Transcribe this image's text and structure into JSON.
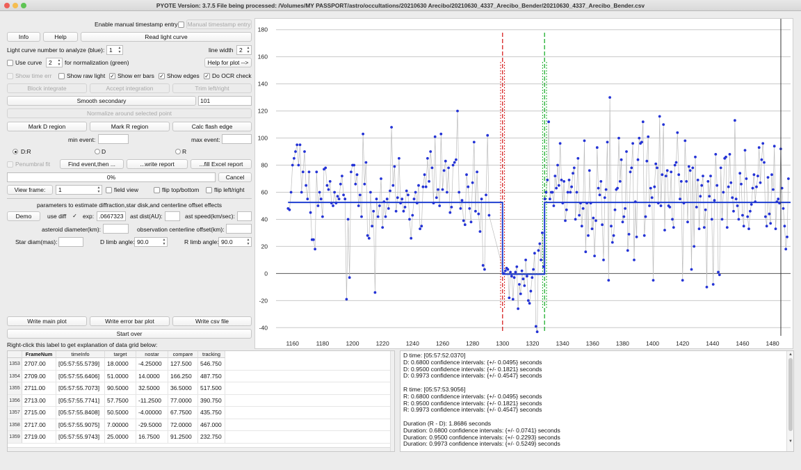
{
  "window": {
    "title": "PYOTE Version: 3.7.5  File being processed: /Volumes/MY PASSPORT/astro/occultations/20210630 Arecibo/20210630_4337_Arecibo_Bender/20210630_4337_Arecibo_Bender.csv"
  },
  "controls": {
    "enable_manual_ts_label": "Enable manual timestamp entry",
    "manual_ts_button": "Manual timestamp entry",
    "info_button": "Info",
    "help_button": "Help",
    "read_lc_button": "Read light curve",
    "lc_number_label": "Light curve number to analyze (blue):",
    "lc_number_value": "1",
    "line_width_label": "line width",
    "line_width_value": "2",
    "use_curve_label": "Use curve",
    "use_curve_value": "2",
    "normalization_label": "for normalization (green)",
    "help_plot_button": "Help for plot -->",
    "show_timer_label": "Show time err",
    "show_raw_label": "Show raw light",
    "show_err_label": "Show err bars",
    "show_edges_label": "Show edges",
    "ocr_label": "Do OCR check",
    "block_integrate_button": "Block integrate",
    "accept_integration_button": "Accept integration",
    "trim_button": "Trim left/right",
    "smooth_button": "Smooth secondary",
    "smooth_value": "101",
    "normalize_button": "Normalize around selected point",
    "mark_d_button": "Mark D region",
    "mark_r_button": "Mark R region",
    "calc_flash_button": "Calc flash edge",
    "min_event_label": "min event:",
    "max_event_label": "max event:",
    "radio_dr": "D:R",
    "radio_d": "D",
    "radio_r": "R",
    "penumbral_label": "Penumbral fit",
    "find_event_button": "Find event,then ...",
    "write_report_button": "...write report",
    "fill_excel_button": "...fill Excel report",
    "progress_text": "0%",
    "cancel_button": "Cancel",
    "view_frame_button": "View frame:",
    "view_frame_value": "1",
    "field_view_label": "field view",
    "flip_tb_label": "flip top/bottom",
    "flip_lr_label": "flip left/right",
    "params_header": "parameters to estimate diffraction,star disk,and centerline offset effects",
    "demo_button": "Demo",
    "use_diff_label": "use diff",
    "exp_label": "exp:",
    "exp_value": ".0667323",
    "ast_dist_label": "ast dist(AU):",
    "ast_speed_label": "ast speed(km/sec):",
    "ast_diam_label": "asteroid diameter(km):",
    "obs_offset_label": "observation centerline offset(km):",
    "star_diam_label": "Star diam(mas):",
    "d_limb_label": "D limb angle:",
    "d_limb_value": "90.0",
    "r_limb_label": "R limb angle:",
    "r_limb_value": "90.0",
    "write_main_button": "Write main plot",
    "write_errbar_button": "Write error bar plot",
    "write_csv_button": "Write csv file",
    "start_over_button": "Start over",
    "grid_help_label": "Right-click this label to get explanation of data grid below:"
  },
  "chart_data": {
    "type": "scatter",
    "title": "",
    "xlabel": "",
    "ylabel": "",
    "xlim": [
      1149,
      1492
    ],
    "ylim": [
      -46,
      186
    ],
    "xticks": [
      1160,
      1180,
      1200,
      1220,
      1240,
      1260,
      1280,
      1300,
      1320,
      1340,
      1360,
      1380,
      1400,
      1420,
      1440,
      1460,
      1480
    ],
    "yticks": [
      -40,
      -20,
      0,
      20,
      40,
      60,
      80,
      100,
      120,
      140,
      160,
      180
    ],
    "series": [
      {
        "values": [
          48,
          47,
          60,
          80,
          85,
          90,
          95,
          80,
          95,
          60,
          75,
          90,
          65,
          55,
          75,
          45,
          25,
          25,
          18,
          75,
          50,
          60,
          55,
          42,
          77,
          78,
          65,
          62,
          68,
          52,
          50,
          60,
          52,
          57,
          55,
          66,
          72,
          58,
          55,
          -19,
          40,
          -3,
          75,
          80,
          80,
          66,
          73,
          50,
          58,
          42,
          103,
          66,
          82,
          28,
          26,
          60,
          35,
          46,
          -14,
          55,
          42,
          50,
          70,
          34,
          53,
          42,
          55,
          48,
          61,
          108,
          65,
          79,
          46,
          56,
          85,
          52,
          55,
          46,
          49,
          61,
          58,
          40,
          26,
          43,
          55,
          60,
          52,
          65,
          33,
          35,
          64,
          73,
          64,
          85,
          68,
          90,
          78,
          52,
          101,
          56,
          62,
          50,
          103,
          62,
          76,
          83,
          60,
          78,
          45,
          49,
          80,
          82,
          84,
          120,
          60,
          48,
          54,
          39,
          36,
          73,
          64,
          48,
          38,
          67,
          97,
          46,
          75,
          44,
          31,
          55,
          6,
          3,
          58,
          102,
          43
        ]
      },
      {
        "values": [
          0,
          2,
          4,
          3,
          -18,
          1,
          -2,
          -19,
          -3,
          1,
          5,
          -26,
          -8,
          -15,
          2,
          -4,
          -9,
          10,
          -2,
          -20,
          -22,
          -13,
          -3,
          3,
          15,
          -39,
          -43,
          17,
          22,
          10,
          30,
          5,
          55,
          60,
          69,
          112,
          55,
          60,
          60,
          50,
          72,
          63,
          80,
          65,
          96,
          69,
          52,
          68,
          39,
          47,
          60,
          69,
          60,
          64,
          74,
          78,
          40,
          60,
          85,
          43,
          52,
          35,
          48,
          98,
          16,
          52,
          28,
          76,
          52,
          33,
          41,
          13,
          39,
          93,
          63,
          58,
          68,
          36,
          10,
          56,
          62,
          97,
          -5,
          130,
          35,
          23,
          28,
          47,
          62,
          63,
          100,
          68,
          84,
          38,
          42,
          48,
          90,
          17,
          29,
          75,
          78,
          96,
          10,
          53,
          27,
          84,
          100,
          96,
          97,
          112,
          28,
          42,
          83,
          101,
          50,
          63,
          56,
          -5,
          64,
          81,
          78,
          52,
          116,
          50,
          73,
          110,
          32,
          72,
          76,
          50,
          49,
          75,
          40,
          34,
          80,
          82,
          104,
          73,
          55,
          68,
          -5,
          52,
          98,
          68,
          38,
          79,
          76,
          3,
          78,
          20,
          86,
          49,
          69,
          33,
          57,
          65,
          72,
          34,
          47,
          -10,
          68,
          57,
          72,
          40,
          -8,
          54,
          88,
          65,
          1,
          -1,
          78,
          40,
          60,
          85,
          86,
          34,
          64,
          88,
          67,
          56,
          46,
          113,
          55,
          50,
          40,
          74,
          66,
          43,
          35,
          91,
          70,
          42,
          33,
          46,
          51,
          63,
          73,
          53,
          64,
          72,
          93,
          67,
          84,
          96,
          82,
          42,
          35,
          71,
          44,
          37,
          73,
          62,
          94,
          33,
          53,
          55,
          52,
          92,
          63,
          48,
          35,
          18,
          27,
          70
        ]
      }
    ],
    "baseline_level": 52.5,
    "event_level": -0.5,
    "d_edge_frame": 1300,
    "r_edge_frame": 1328
  },
  "grid": {
    "headers": [
      "FrameNum",
      "timeInfo",
      "target",
      "nostar",
      "compare",
      "tracking"
    ],
    "rows": [
      {
        "n": "1353",
        "cells": [
          "2707.00",
          "[05:57:55.5739]",
          "18.0000",
          "-4.25000",
          "127.500",
          "546.750"
        ]
      },
      {
        "n": "1354",
        "cells": [
          "2709.00",
          "[05:57:55.6406]",
          "51.0000",
          "14.0000",
          "166.250",
          "487.750"
        ]
      },
      {
        "n": "1355",
        "cells": [
          "2711.00",
          "[05:57:55.7073]",
          "90.5000",
          "32.5000",
          "36.5000",
          "517.500"
        ]
      },
      {
        "n": "1356",
        "cells": [
          "2713.00",
          "[05:57:55.7741]",
          "57.7500",
          "-11.2500",
          "77.0000",
          "390.750"
        ]
      },
      {
        "n": "1357",
        "cells": [
          "2715.00",
          "[05:57:55.8408]",
          "50.5000",
          "-4.00000",
          "67.7500",
          "435.750"
        ]
      },
      {
        "n": "1358",
        "cells": [
          "2717.00",
          "[05:57:55.9075]",
          "7.00000",
          "-29.5000",
          "72.0000",
          "467.000"
        ]
      },
      {
        "n": "1359",
        "cells": [
          "2719.00",
          "[05:57:55.9743]",
          "25.0000",
          "16.7500",
          "91.2500",
          "232.750"
        ]
      }
    ]
  },
  "log": [
    "D time: [05:57:52.0370]",
    "D: 0.6800 confidence intervals: {+/- 0.0495} seconds",
    "D: 0.9500 confidence intervals: {+/- 0.1821} seconds",
    "D: 0.9973 confidence intervals: {+/- 0.4547} seconds",
    "",
    "R time: [05:57:53.9056]",
    "R: 0.6800 confidence intervals: {+/- 0.0495} seconds",
    "R: 0.9500 confidence intervals: {+/- 0.1821} seconds",
    "R: 0.9973 confidence intervals: {+/- 0.4547} seconds",
    "",
    "Duration (R - D): 1.8686 seconds",
    "Duration: 0.6800 confidence intervals: {+/- 0.0741} seconds",
    "Duration: 0.9500 confidence intervals: {+/- 0.2293} seconds",
    "Duration: 0.9973 confidence intervals: {+/- 0.5249} seconds"
  ]
}
